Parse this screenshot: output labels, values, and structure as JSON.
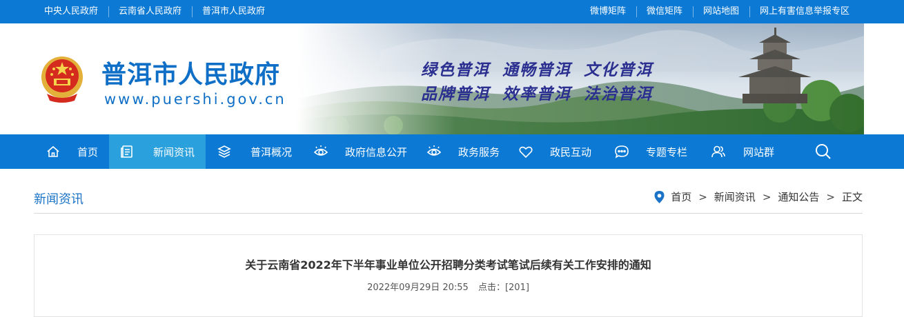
{
  "topbar": {
    "left_links": [
      "中央人民政府",
      "云南省人民政府",
      "普洱市人民政府"
    ],
    "right_links": [
      "微博矩阵",
      "微信矩阵",
      "网站地图",
      "网上有害信息举报专区"
    ]
  },
  "banner": {
    "site_title": "普洱市人民政府",
    "site_url": "www.puershi.gov.cn",
    "slogan_line1": "绿色普洱 通畅普洱 文化普洱",
    "slogan_line2": "品牌普洱 效率普洱 法治普洱"
  },
  "nav": {
    "items": [
      {
        "label": "首页",
        "icon": "home-icon"
      },
      {
        "label": "新闻资讯",
        "icon": "news-icon"
      },
      {
        "label": "普洱概况",
        "icon": "layers-icon"
      },
      {
        "label": "政府信息公开",
        "icon": "eye-icon"
      },
      {
        "label": "政务服务",
        "icon": "eye-icon"
      },
      {
        "label": "政民互动",
        "icon": "heart-icon"
      },
      {
        "label": "专题专栏",
        "icon": "chat-icon"
      },
      {
        "label": "网站群",
        "icon": "users-icon"
      }
    ],
    "active_index": 1,
    "search_icon": "search-icon"
  },
  "breadcrumb": {
    "section_title": "新闻资讯",
    "items": [
      "首页",
      "新闻资讯",
      "通知公告",
      "正文"
    ],
    "separator": ">"
  },
  "article": {
    "title": "关于云南省2022年下半年事业单位公开招聘分类考试笔试后续有关工作安排的通知",
    "datetime": "2022年09月29日 20:55",
    "views": "点击：[201]"
  },
  "colors": {
    "primary_blue": "#0c7ad4",
    "nav_active": "#2aa0dc",
    "title_blue": "#0f6fc6",
    "slogan_purple": "#2b2f8f"
  }
}
